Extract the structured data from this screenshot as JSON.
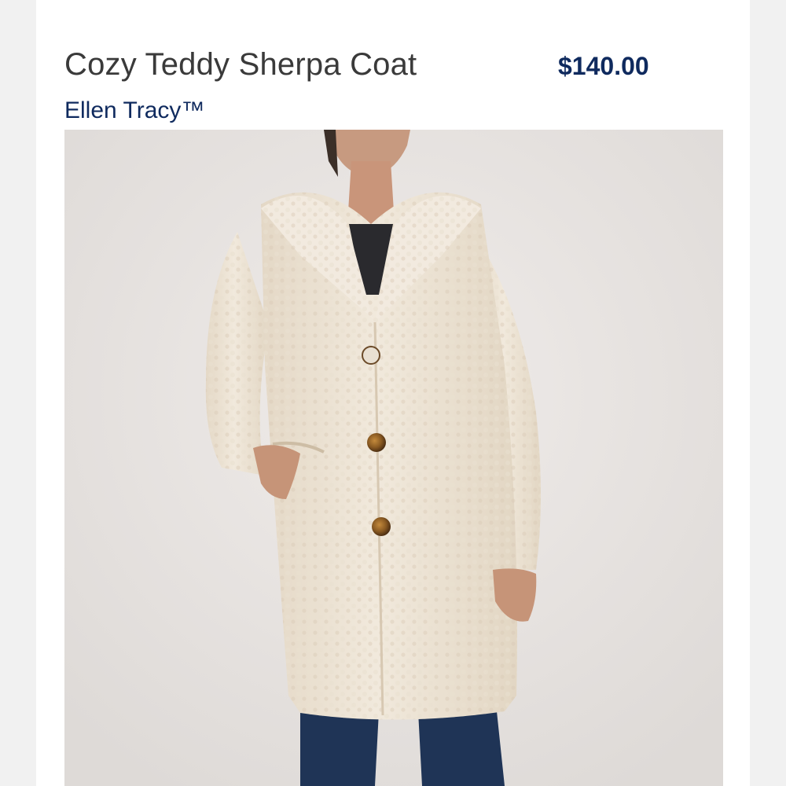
{
  "product": {
    "title": "Cozy Teddy Sherpa Coat",
    "price": "$140.00",
    "brand": "Ellen Tracy™"
  },
  "colors": {
    "title_text": "#3a3a3a",
    "accent_navy": "#0f2a5e",
    "coat_cream": "#efe6d8",
    "button_tortoise": "#8a5a22",
    "jeans_denim": "#1f3456"
  },
  "image": {
    "content": "product-photo-model-wearing-coat"
  }
}
